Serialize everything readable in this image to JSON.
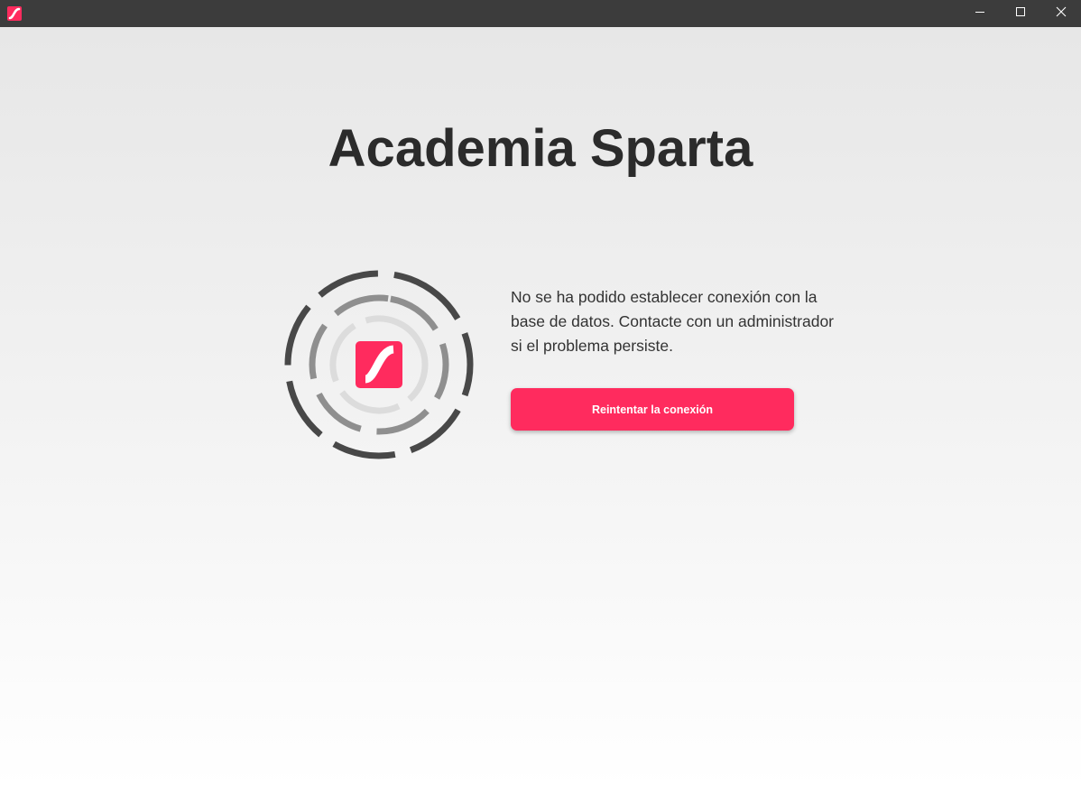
{
  "window": {
    "title_bar": {
      "app_icon": "sparta-logo-icon",
      "controls": {
        "minimize_icon": "minimize-icon",
        "maximize_icon": "maximize-icon",
        "close_icon": "close-icon"
      }
    }
  },
  "main": {
    "title": "Academia Sparta",
    "emblem": {
      "icon": "sparta-logo-icon",
      "ring_colors": [
        "#484848",
        "#8f8f8f",
        "#dcdcdc"
      ]
    },
    "message": "No se ha podido establecer conexión con la base de datos.  Contacte con un administrador si el problema persiste.",
    "retry_button_label": "Reintentar la conexión"
  },
  "colors": {
    "accent": "#ff2b5e",
    "titlebar": "#3c3c3c",
    "text": "#2b2b2b"
  }
}
